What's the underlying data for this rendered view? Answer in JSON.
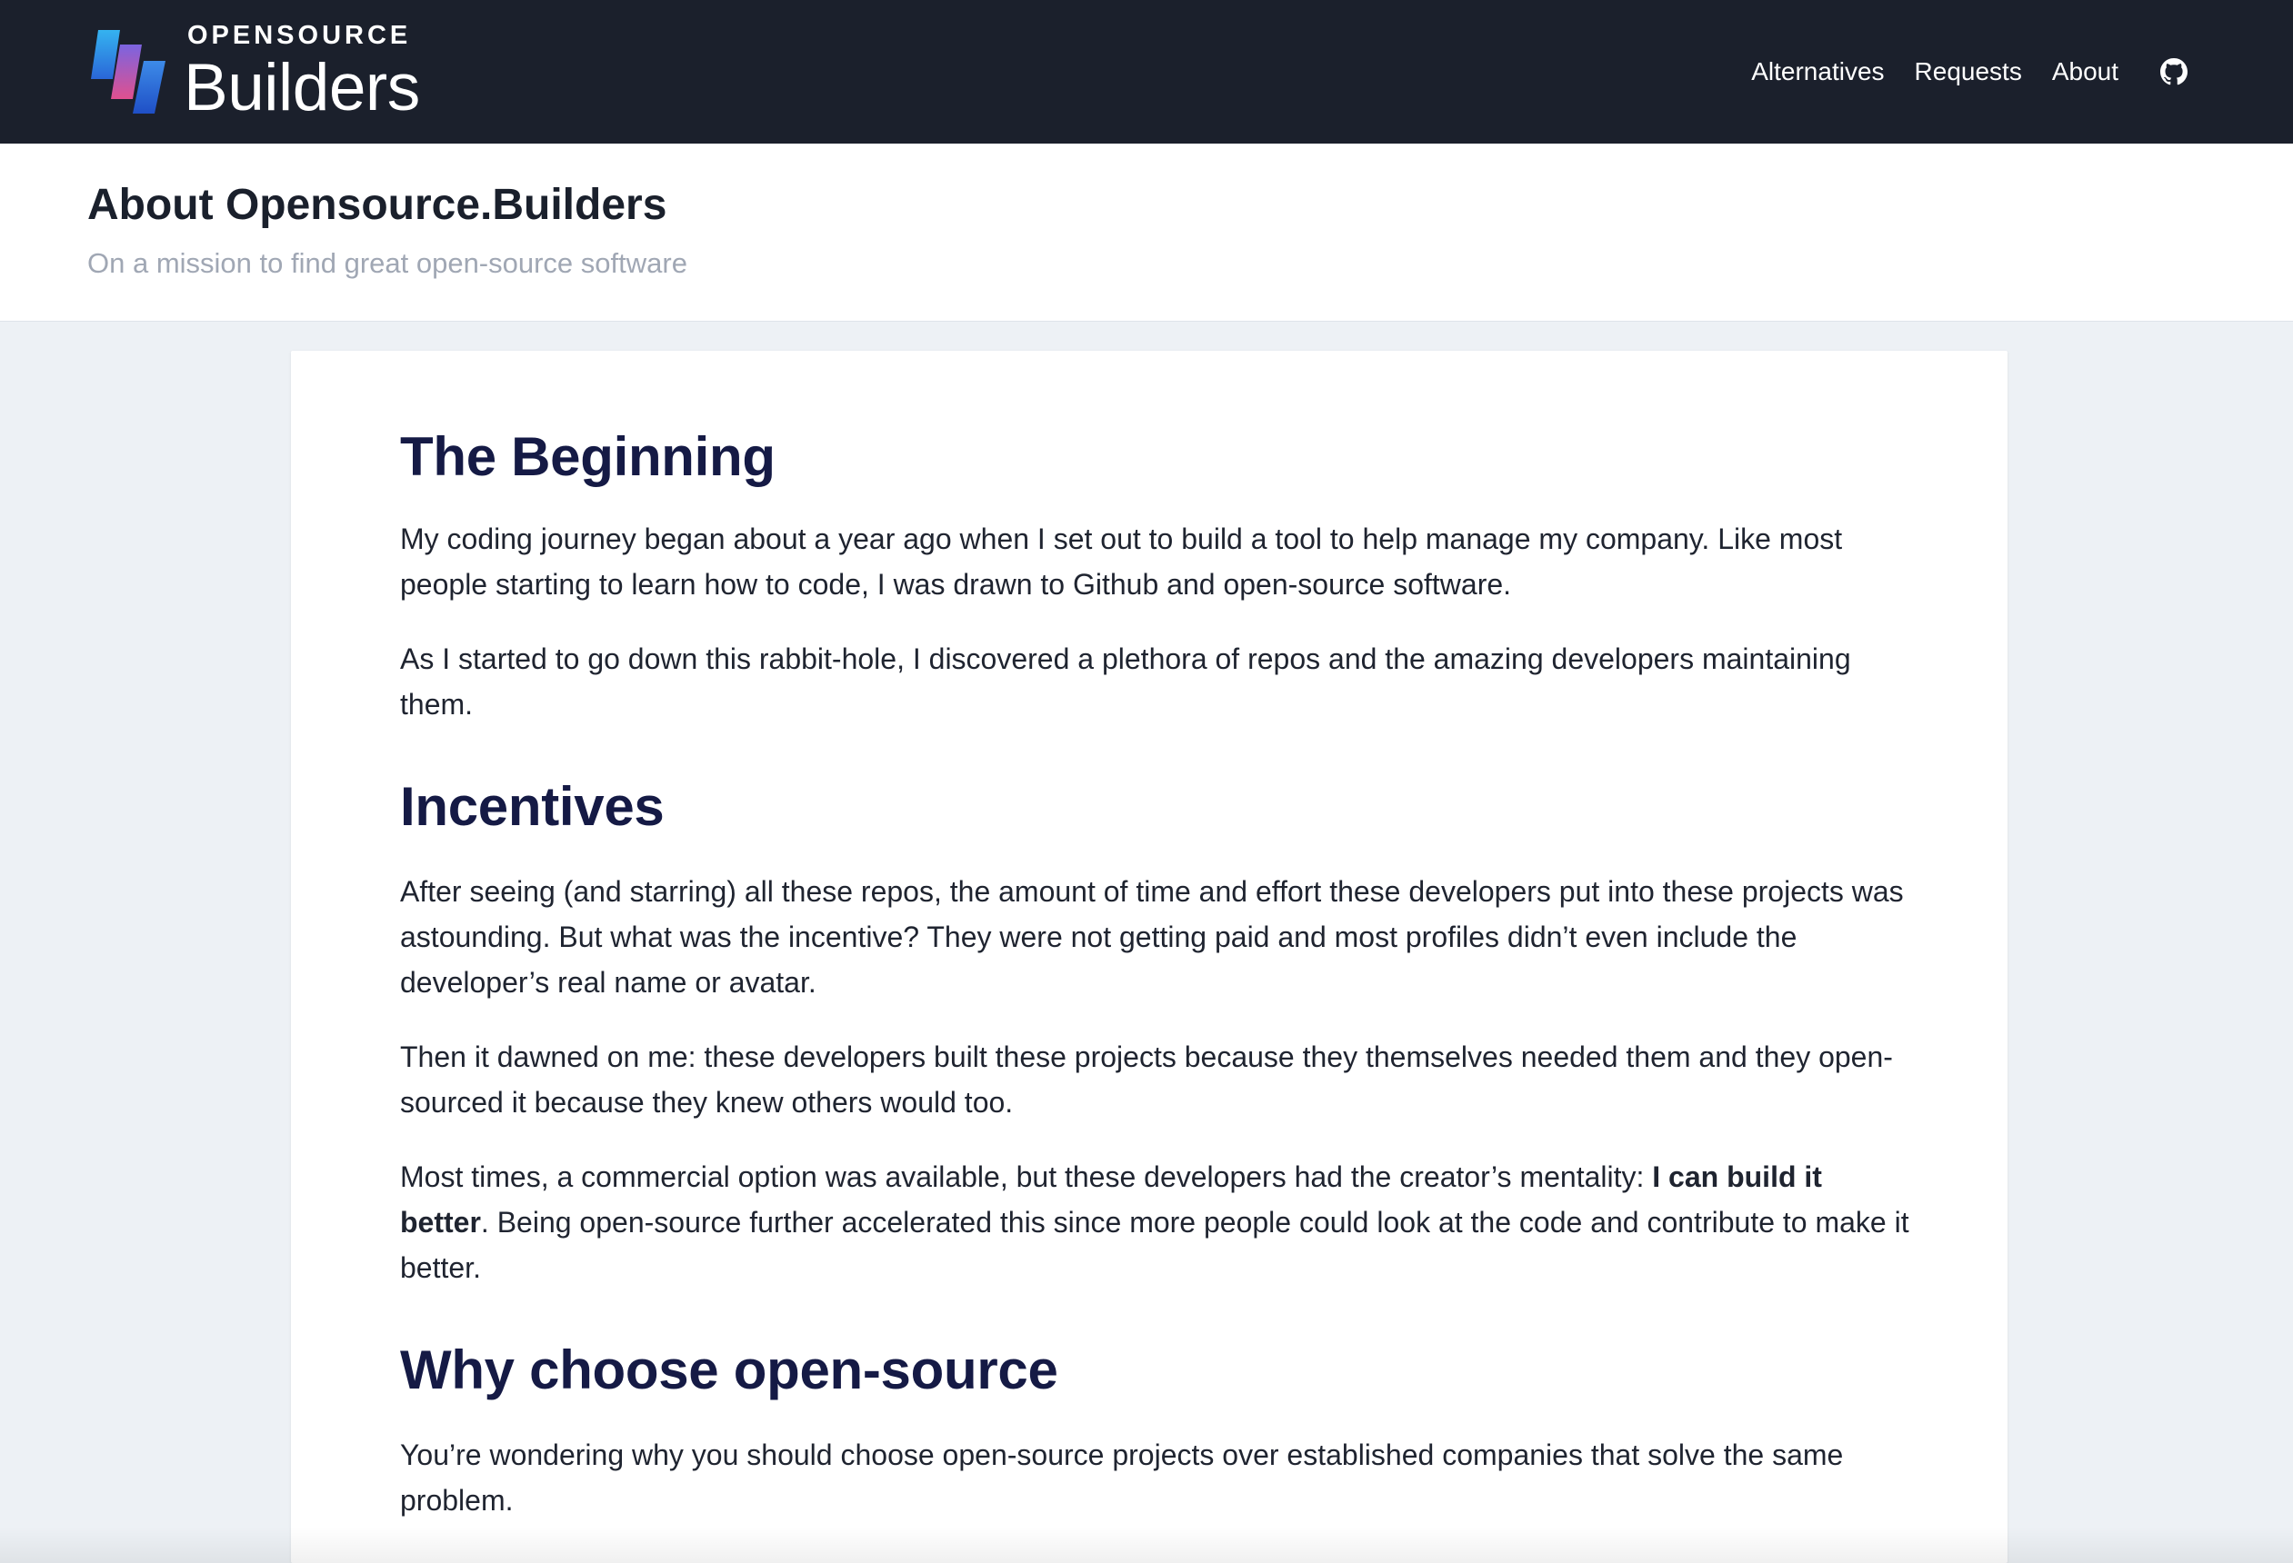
{
  "brand": {
    "small_text": "OPENSOURCE",
    "big_text": "Builders"
  },
  "nav": {
    "items": [
      {
        "label": "Alternatives"
      },
      {
        "label": "Requests"
      },
      {
        "label": "About"
      }
    ],
    "github_icon": "github-icon"
  },
  "header": {
    "title": "About Opensource.Builders",
    "subtitle": "On a mission to find great open-source software"
  },
  "article": {
    "sections": [
      {
        "heading": "The Beginning",
        "paragraphs": [
          "My coding journey began about a year ago when I set out to build a tool to help manage my company. Like most people starting to learn how to code, I was drawn to Github and open-source software.",
          "As I started to go down this rabbit-hole, I discovered a plethora of repos and the amazing developers maintaining them."
        ]
      },
      {
        "heading": "Incentives",
        "paragraphs": [
          "After seeing (and starring) all these repos, the amount of time and effort these developers put into these projects was astounding. But what was the incentive? They were not getting paid and most profiles didn’t even include the developer’s real name or avatar.",
          "Then it dawned on me: these developers built these projects because they themselves needed them and they open-sourced it because they knew others would too."
        ],
        "mixed_paragraph": {
          "before": "Most times, a commercial option was available, but these developers had the creator’s mentality: ",
          "bold": "I can build it better",
          "after": ". Being open-source further accelerated this since more people could look at the code and contribute to make it better."
        }
      },
      {
        "heading": "Why choose open-source",
        "paragraphs": [
          "You’re wondering why you should choose open-source projects over established companies that solve the same problem."
        ]
      }
    ]
  },
  "colors": {
    "topbar_bg": "#1b202c",
    "page_bg": "#edf1f5",
    "heading": "#151a45",
    "subtitle": "#a0a7b4",
    "logo_blue": "#2f7fe0",
    "logo_pink": "#e0508f"
  }
}
